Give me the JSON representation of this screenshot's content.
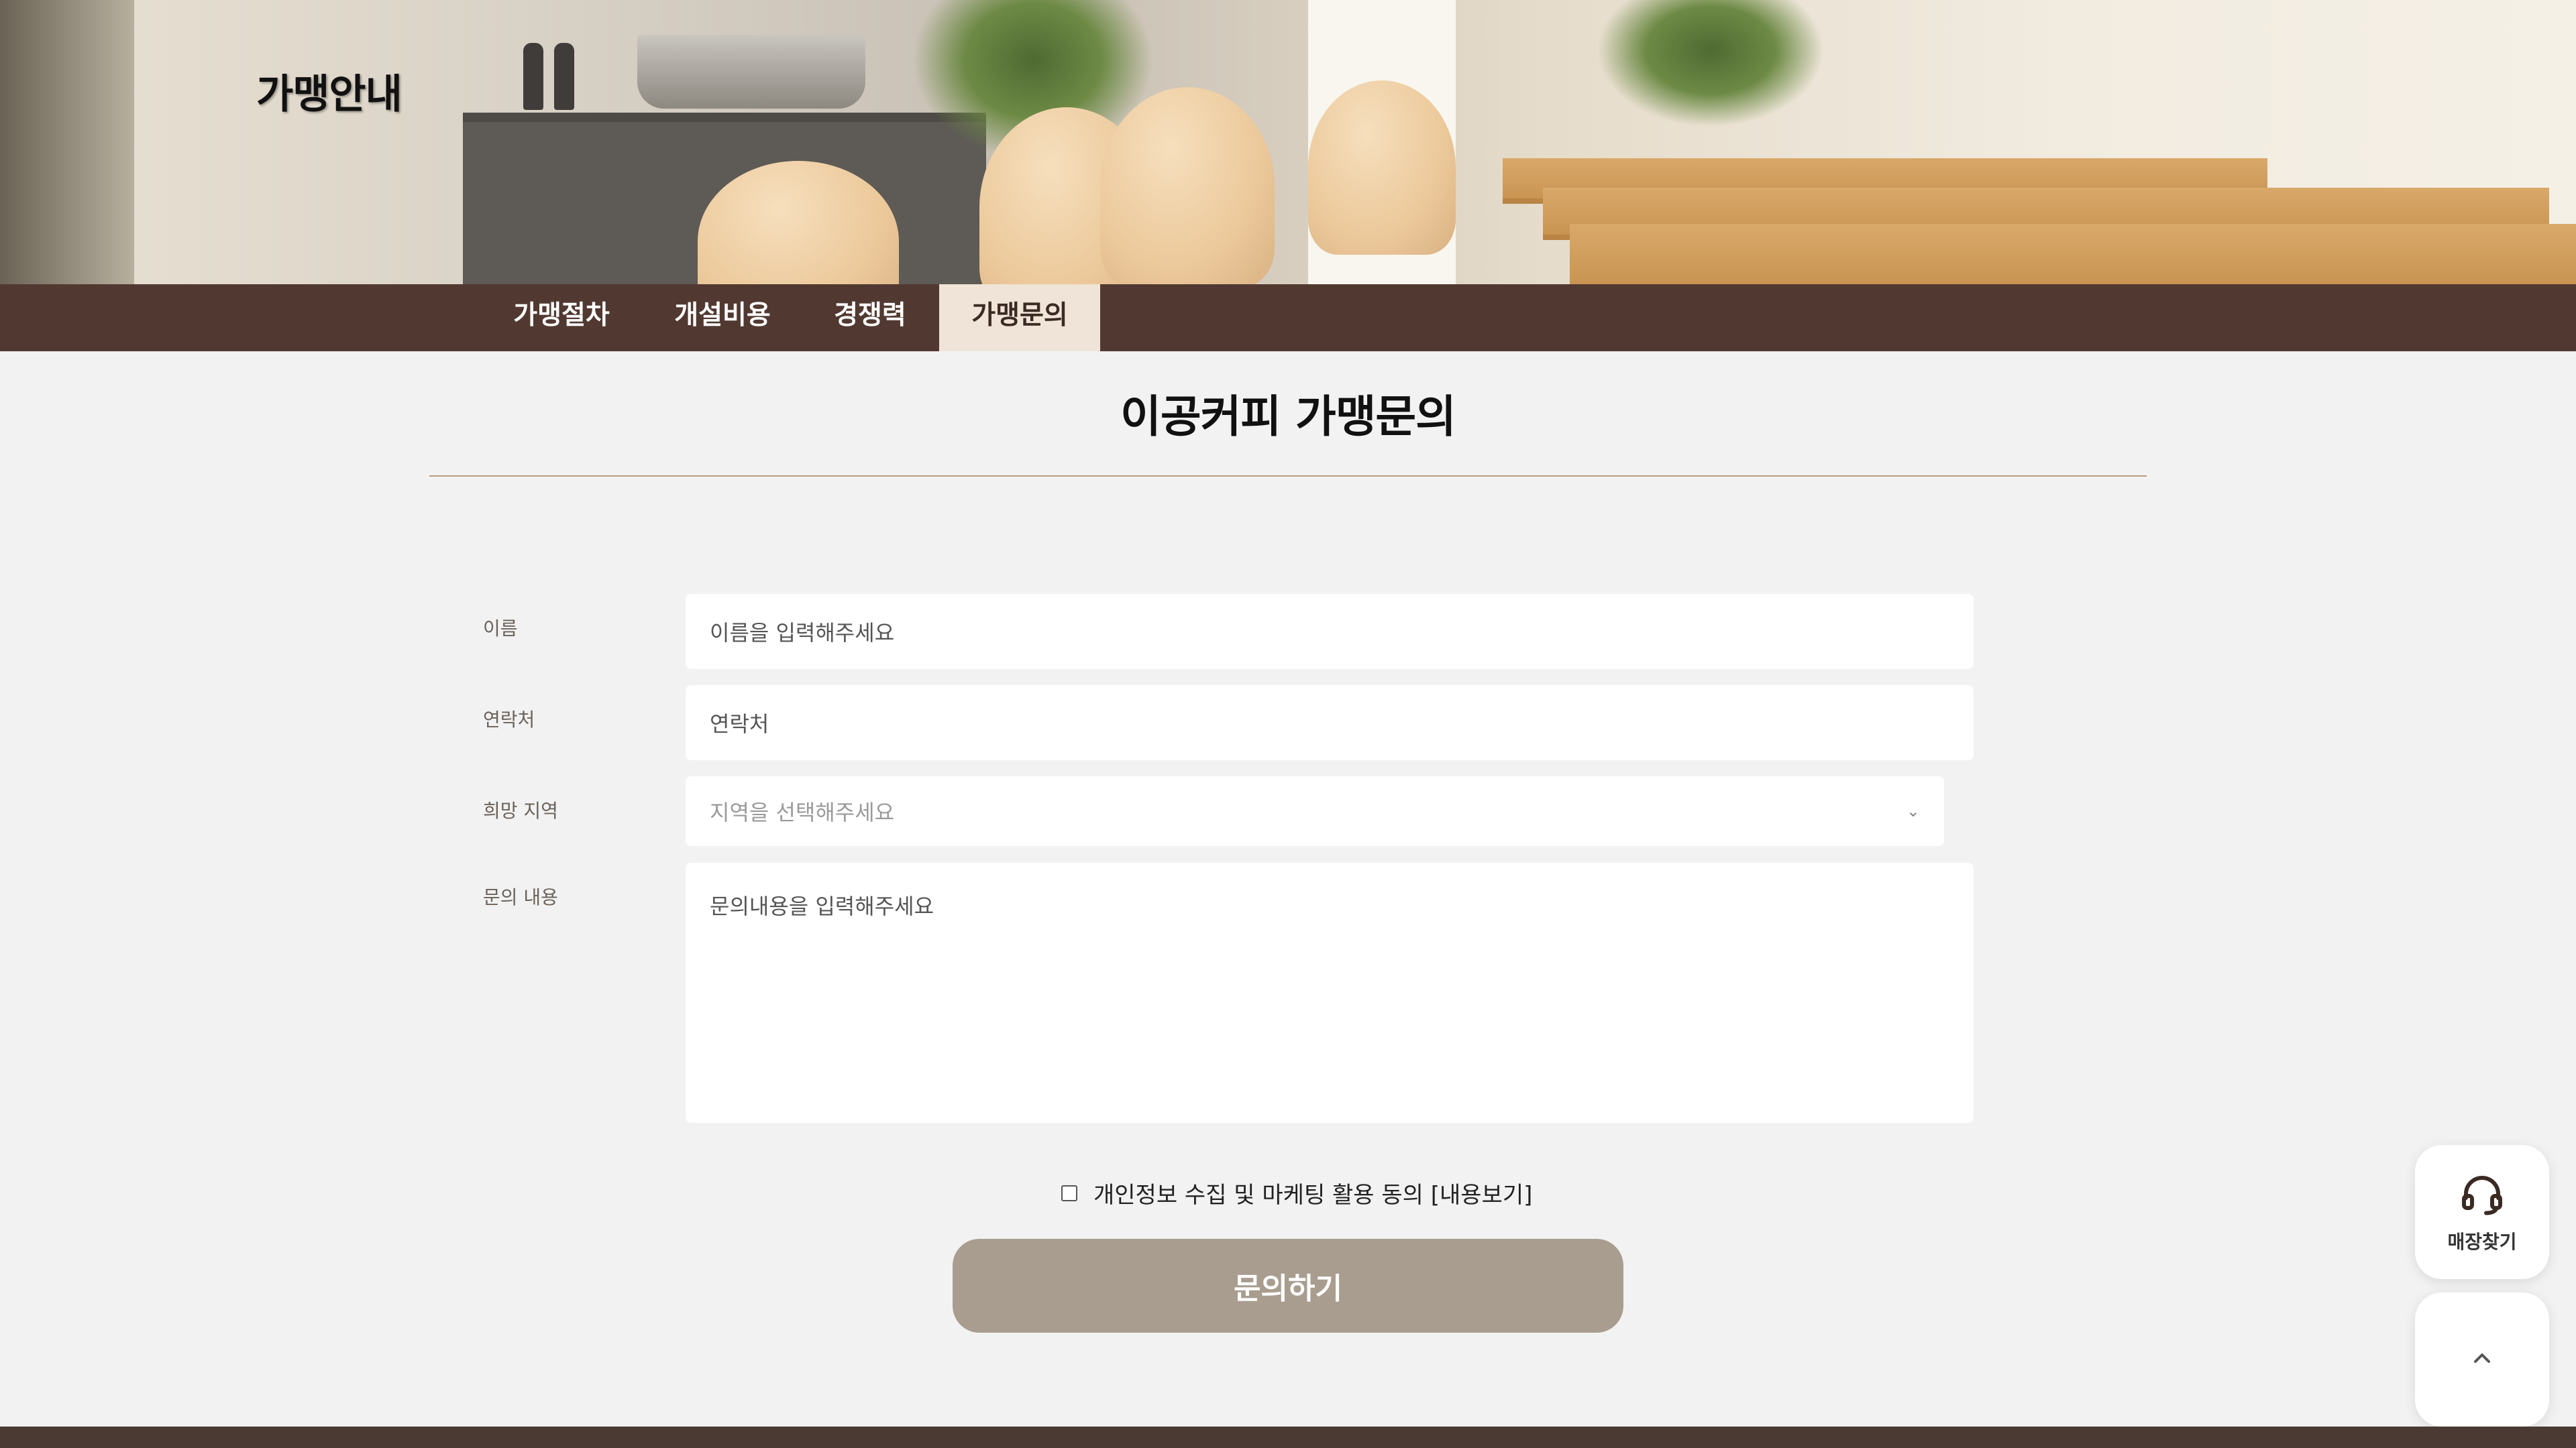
{
  "hero": {
    "title": "가맹안내"
  },
  "tabs": [
    {
      "label": "가맹절차",
      "active": false
    },
    {
      "label": "개설비용",
      "active": false
    },
    {
      "label": "경쟁력",
      "active": false
    },
    {
      "label": "가맹문의",
      "active": true
    }
  ],
  "page_title": "이공커피 가맹문의",
  "form": {
    "name": {
      "label": "이름",
      "placeholder": "이름을 입력해주세요"
    },
    "contact": {
      "label": "연락처",
      "placeholder": "연락처"
    },
    "region": {
      "label": "희망 지역",
      "selected": "지역을 선택해주세요"
    },
    "message": {
      "label": "문의 내용",
      "placeholder": "문의내용을 입력해주세요"
    },
    "consent_label": "개인정보 수집 및 마케팅 활용 동의 [내용보기]",
    "consent_checked": false,
    "submit_label": "문의하기"
  },
  "floating": {
    "store_finder": {
      "label": "매장찾기",
      "icon": "headset-icon"
    },
    "scroll_top": {
      "icon": "chevron-up-icon"
    }
  },
  "colors": {
    "tab_bar": "#513931",
    "tab_active": "#f0e4d8",
    "submit_button": "#a89d8f",
    "accent_rule": "#b89c7e"
  }
}
